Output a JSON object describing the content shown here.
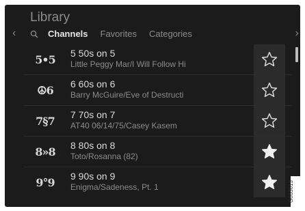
{
  "header": {
    "title": "Library",
    "tabs": [
      "Channels",
      "Favorites",
      "Categories"
    ],
    "active_tab": "Channels"
  },
  "channels": [
    {
      "logo": "5•5",
      "name": "5 50s on 5",
      "song": "Little Peggy Mar/I Will Follow Hi",
      "favorite": false
    },
    {
      "logo": "☮6",
      "name": "6 60s on 6",
      "song": "Barry McGuire/Eve of Destructi",
      "favorite": false
    },
    {
      "logo": "7§7",
      "name": "7 70s on 7",
      "song": "AT40 06/14/75/Casey Kasem",
      "favorite": false
    },
    {
      "logo": "8»8",
      "name": "8 80s on 8",
      "song": "Toto/Rosanna (82)",
      "favorite": true
    },
    {
      "logo": "9°9",
      "name": "9 90s on 9",
      "song": "Enigma/Sadeness, Pt. 1",
      "favorite": true
    }
  ],
  "figure_id": "G063613"
}
